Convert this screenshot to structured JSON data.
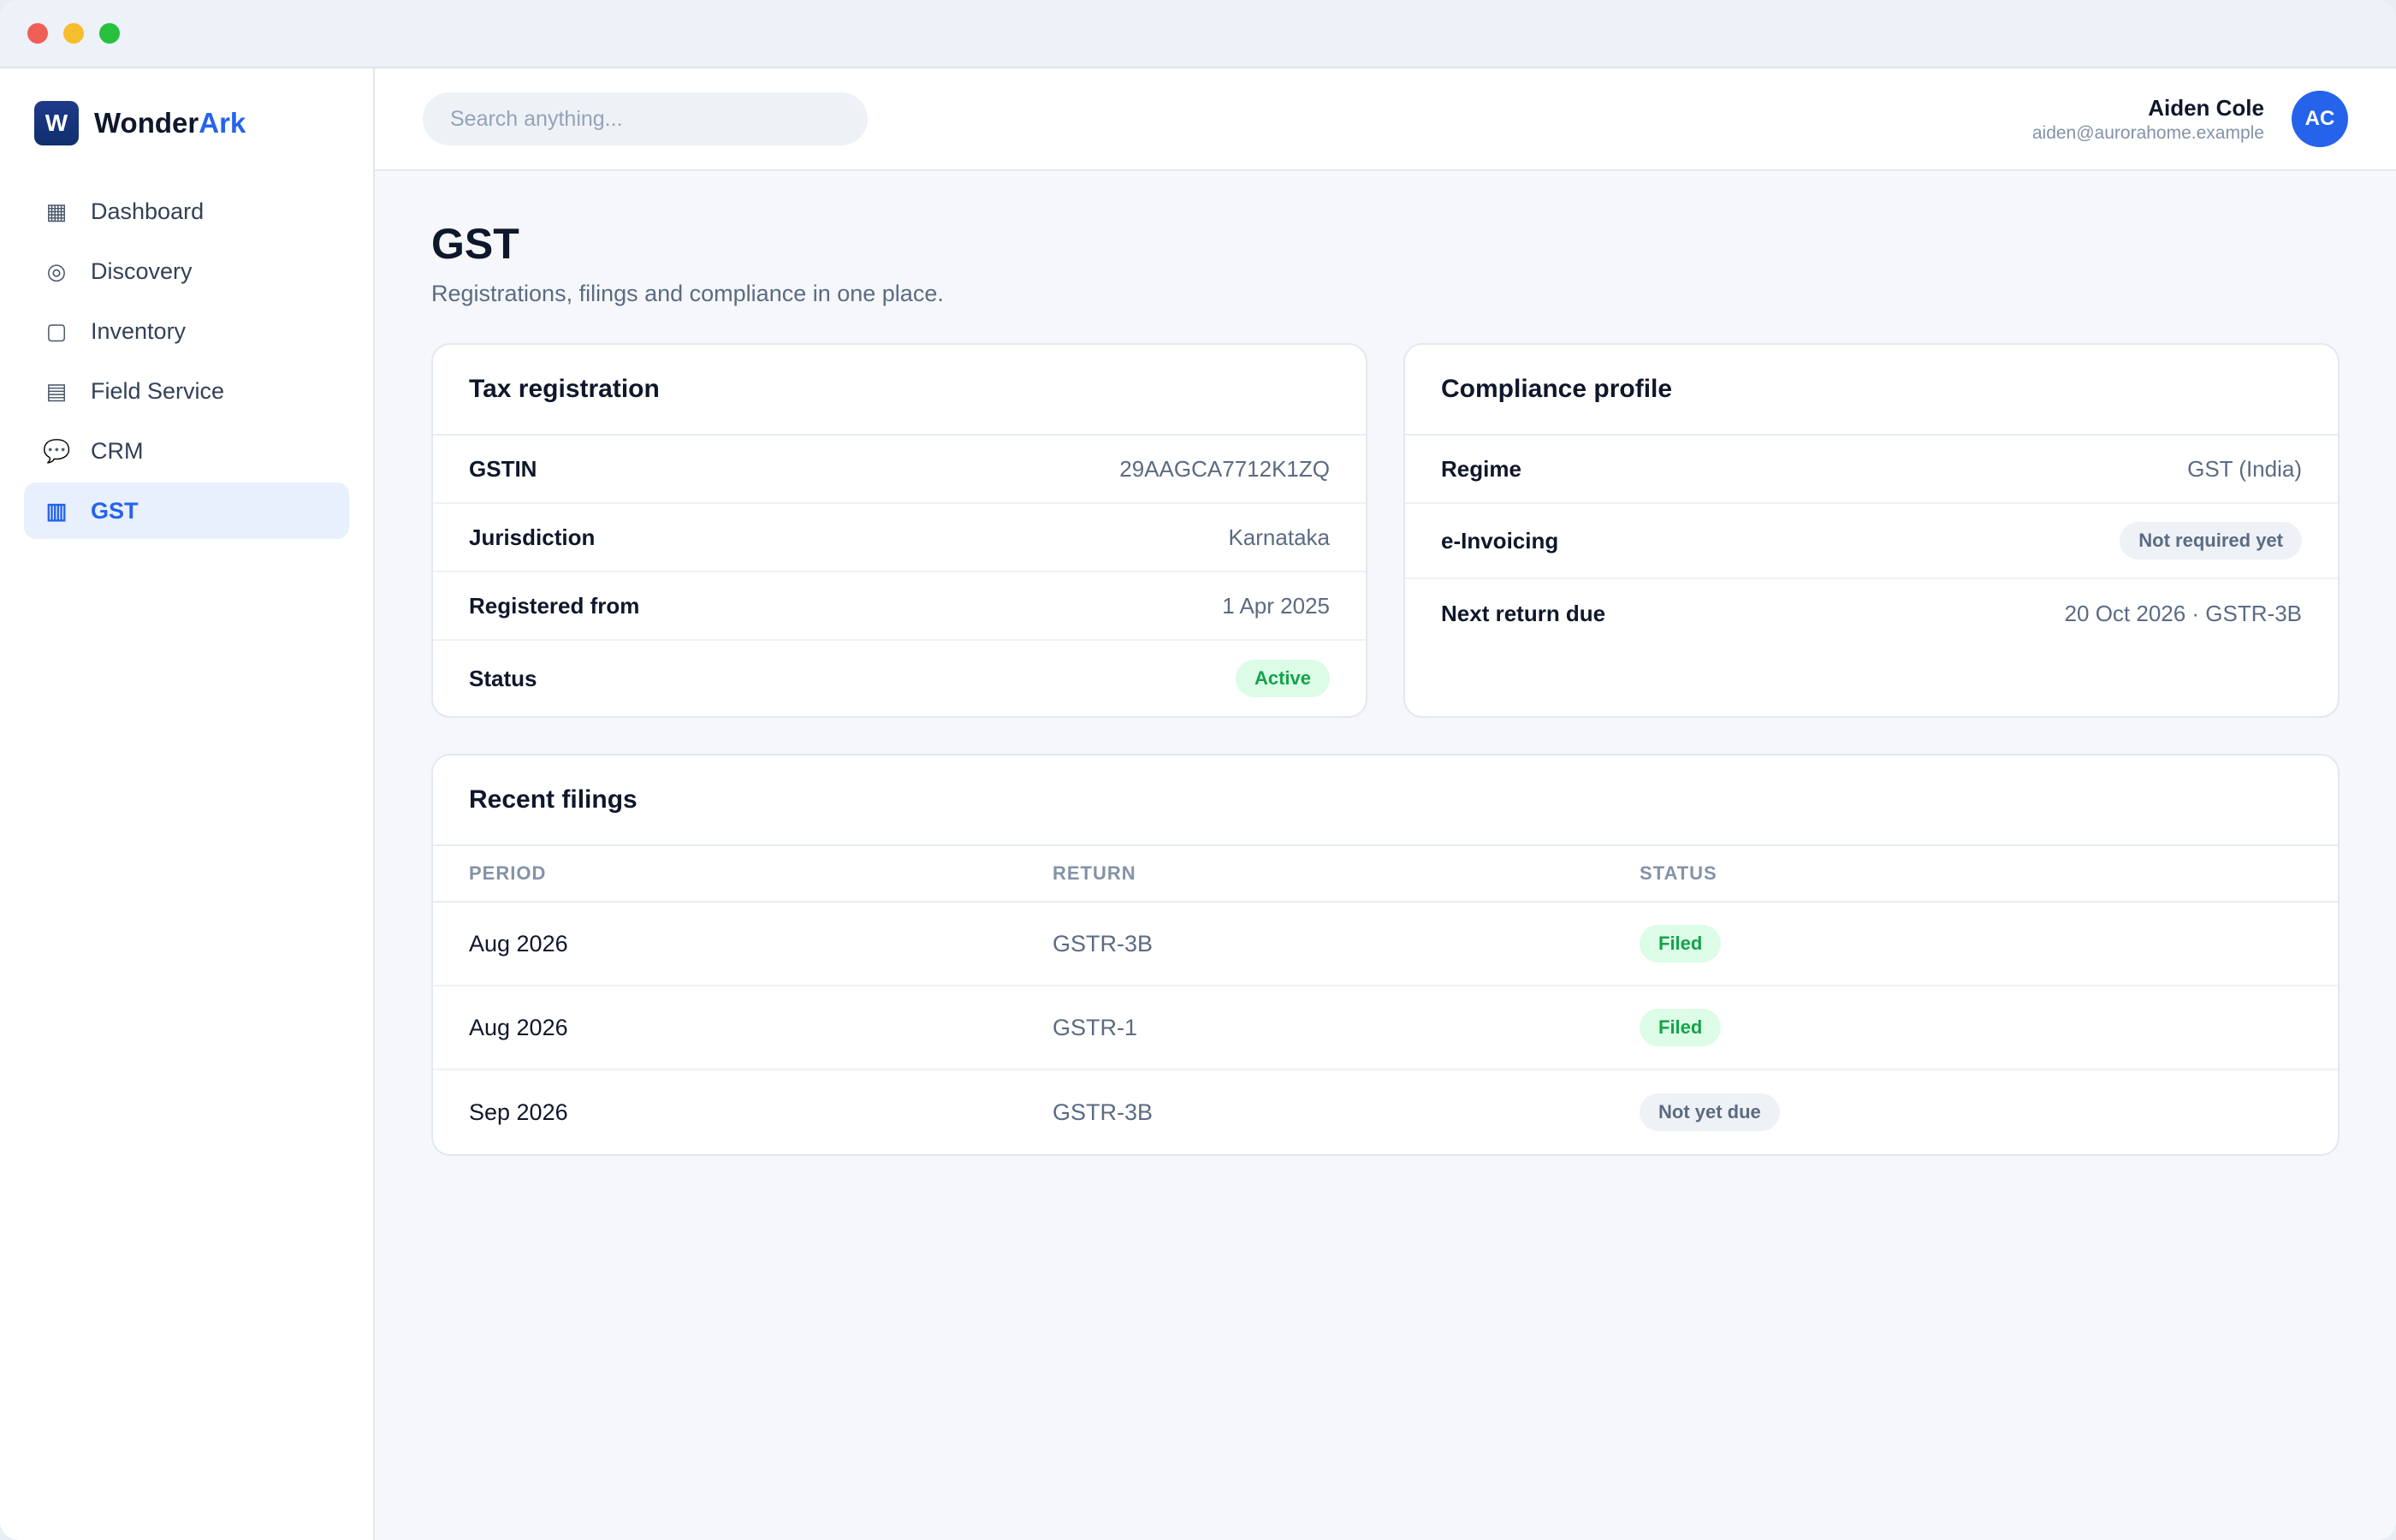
{
  "brand": {
    "logo_letter": "W",
    "name_part1": "Wonder",
    "name_part2": "Ark"
  },
  "sidebar": {
    "items": [
      {
        "label": "Dashboard",
        "icon": "▦",
        "active": false
      },
      {
        "label": "Discovery",
        "icon": "◎",
        "active": false
      },
      {
        "label": "Inventory",
        "icon": "▢",
        "active": false
      },
      {
        "label": "Field Service",
        "icon": "▤",
        "active": false
      },
      {
        "label": "CRM",
        "icon": "💬",
        "active": false
      },
      {
        "label": "GST",
        "icon": "▥",
        "active": true
      }
    ]
  },
  "topbar": {
    "search_placeholder": "Search anything...",
    "user_name": "Aiden Cole",
    "user_email": "aiden@aurorahome.example",
    "avatar_initials": "AC"
  },
  "page": {
    "title": "GST",
    "subtitle": "Registrations, filings and compliance in one place."
  },
  "tax_registration": {
    "title": "Tax registration",
    "rows": [
      {
        "label": "GSTIN",
        "value": "29AAGCA7712K1ZQ"
      },
      {
        "label": "Jurisdiction",
        "value": "Karnataka"
      },
      {
        "label": "Registered from",
        "value": "1 Apr 2025"
      },
      {
        "label": "Status",
        "value": "Active"
      }
    ]
  },
  "compliance_profile": {
    "title": "Compliance profile",
    "rows": [
      {
        "label": "Regime",
        "value": "GST (India)"
      },
      {
        "label": "e-Invoicing",
        "value": "Not required yet"
      },
      {
        "label": "Next return due",
        "value": "20 Oct 2026 · GSTR-3B"
      }
    ]
  },
  "recent_filings": {
    "title": "Recent filings",
    "columns": [
      "PERIOD",
      "RETURN",
      "STATUS"
    ],
    "rows": [
      {
        "period": "Aug 2026",
        "return": "GSTR-3B",
        "status": "Filed"
      },
      {
        "period": "Aug 2026",
        "return": "GSTR-1",
        "status": "Filed"
      },
      {
        "period": "Sep 2026",
        "return": "GSTR-3B",
        "status": "Not yet due"
      }
    ]
  },
  "colors": {
    "accent": "#2563eb",
    "success_bg": "#dcfce7",
    "success_text": "#16a34a",
    "neutral_badge_bg": "#eef2f7"
  }
}
